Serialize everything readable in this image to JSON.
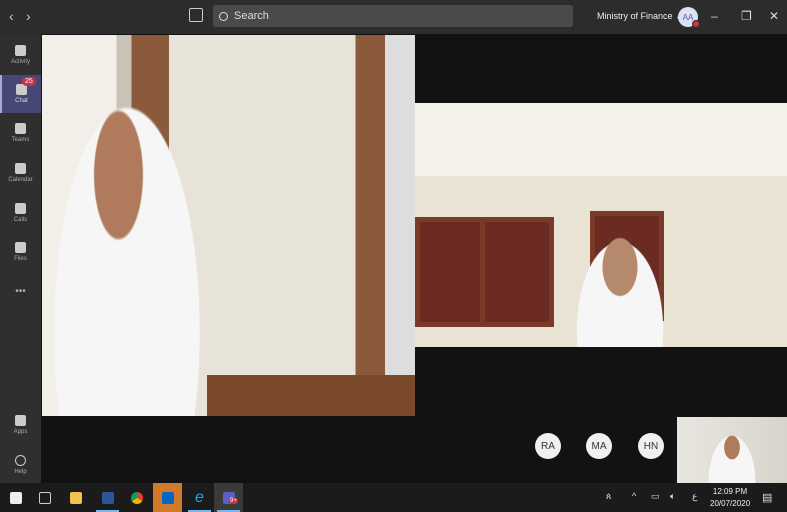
{
  "titlebar": {
    "back": "‹",
    "forward": "›",
    "search_placeholder": "Search",
    "org": "Ministry of Finance",
    "org_chevron": "⌄",
    "avatar_initials": "AA",
    "minimize": "–",
    "maximize": "❐",
    "close": "✕"
  },
  "rail": {
    "items": [
      {
        "label": "Activity"
      },
      {
        "label": "Chat",
        "badge": "25"
      },
      {
        "label": "Teams"
      },
      {
        "label": "Calendar"
      },
      {
        "label": "Calls"
      },
      {
        "label": "Files"
      }
    ],
    "more": "•••",
    "apps": "Apps",
    "help": "Help"
  },
  "call": {
    "participants": [
      "RA",
      "MA",
      "HN"
    ]
  },
  "taskbar": {
    "time": "12:09 PM",
    "date": "20/07/2020",
    "lang": "ع",
    "teams_badge": "9+"
  },
  "colors": {
    "accent": "#464775",
    "badge": "#c4314b"
  }
}
